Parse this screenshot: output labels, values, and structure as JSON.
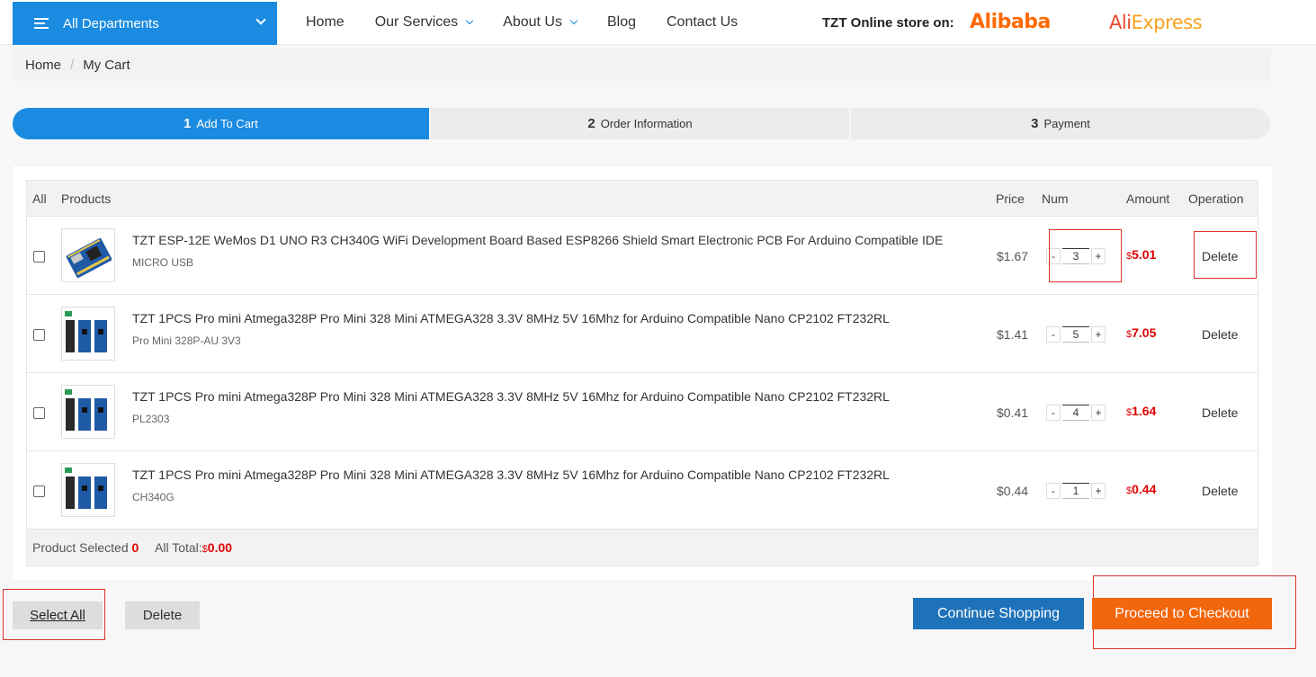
{
  "header": {
    "departments_label": "All Departments",
    "nav": [
      {
        "label": "Home",
        "has_dropdown": false
      },
      {
        "label": "Our Services",
        "has_dropdown": true
      },
      {
        "label": "About Us",
        "has_dropdown": true
      },
      {
        "label": "Blog",
        "has_dropdown": false
      },
      {
        "label": "Contact Us",
        "has_dropdown": false
      }
    ],
    "store_label": "TZT Online store on:",
    "alibaba_logo": "Alibaba",
    "aliexpress_logo": "AliExpress"
  },
  "breadcrumb": {
    "home": "Home",
    "sep": "/",
    "current": "My Cart"
  },
  "steps": [
    {
      "num": "1",
      "label": "Add To Cart",
      "active": true
    },
    {
      "num": "2",
      "label": "Order Information",
      "active": false
    },
    {
      "num": "3",
      "label": "Payment",
      "active": false
    }
  ],
  "table": {
    "headers": {
      "all": "All",
      "products": "Products",
      "price": "Price",
      "num": "Num",
      "amount": "Amount",
      "operation": "Operation"
    },
    "rows": [
      {
        "title": "TZT ESP-12E WeMos D1 UNO R3 CH340G WiFi Development Board Based ESP8266 Shield Smart Electronic PCB For Arduino Compatible IDE",
        "sku": "MICRO USB",
        "price": "$1.67",
        "qty": "3",
        "currency": "$",
        "amount": "5.01",
        "delete": "Delete",
        "minus": "-",
        "plus": "+"
      },
      {
        "title": "TZT 1PCS Pro mini Atmega328P Pro Mini 328 Mini ATMEGA328 3.3V 8MHz 5V 16Mhz for Arduino Compatible Nano CP2102 FT232RL",
        "sku": "Pro Mini 328P-AU 3V3",
        "price": "$1.41",
        "qty": "5",
        "currency": "$",
        "amount": "7.05",
        "delete": "Delete",
        "minus": "-",
        "plus": "+"
      },
      {
        "title": "TZT 1PCS Pro mini Atmega328P Pro Mini 328 Mini ATMEGA328 3.3V 8MHz 5V 16Mhz for Arduino Compatible Nano CP2102 FT232RL",
        "sku": "PL2303",
        "price": "$0.41",
        "qty": "4",
        "currency": "$",
        "amount": "1.64",
        "delete": "Delete",
        "minus": "-",
        "plus": "+"
      },
      {
        "title": "TZT 1PCS Pro mini Atmega328P Pro Mini 328 Mini ATMEGA328 3.3V 8MHz 5V 16Mhz for Arduino Compatible Nano CP2102 FT232RL",
        "sku": "CH340G",
        "price": "$0.44",
        "qty": "1",
        "currency": "$",
        "amount": "0.44",
        "delete": "Delete",
        "minus": "-",
        "plus": "+"
      }
    ],
    "footer": {
      "selected_label": "Product Selected",
      "selected_count": "0",
      "total_label": "All Total:",
      "currency": "$",
      "total_value": "0.00"
    }
  },
  "buttons": {
    "select_all": "Select All",
    "delete": "Delete",
    "continue": "Continue Shopping",
    "checkout": "Proceed to Checkout"
  },
  "colors": {
    "primary": "#1a8be0",
    "checkout": "#f2660c",
    "price_red": "#e00000",
    "highlight": "#d9342b"
  }
}
